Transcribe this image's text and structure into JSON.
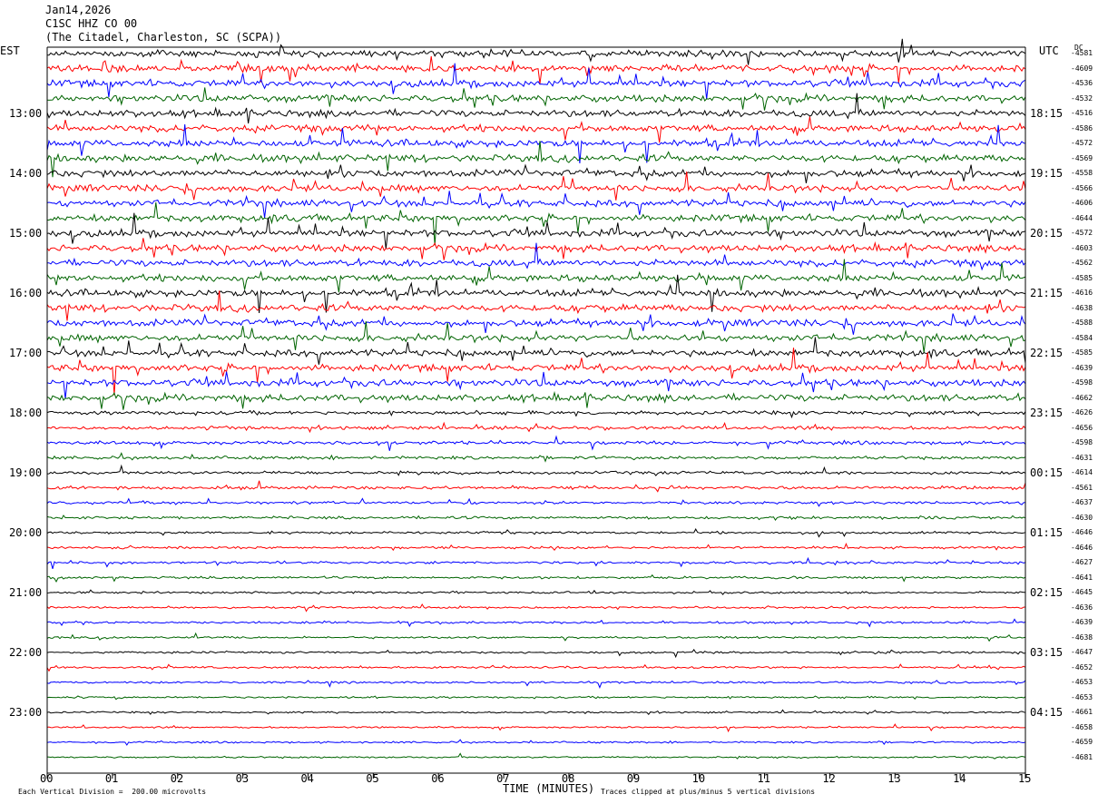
{
  "header": {
    "date": "Jan14,2026",
    "channel": "C1SC HHZ CO 00",
    "station": "(The Citadel, Charleston, SC (SCPA))"
  },
  "chart_data": {
    "type": "line",
    "title": "",
    "xlabel": "TIME (MINUTES)",
    "x_ticks": [
      "00",
      "01",
      "02",
      "03",
      "04",
      "05",
      "06",
      "07",
      "08",
      "09",
      "10",
      "11",
      "12",
      "13",
      "14",
      "15"
    ],
    "xlim": [
      0,
      15
    ],
    "left_axis_label": "EST",
    "right_axis_label": "UTC",
    "dc_label": "DC",
    "left_hour_labels": [
      "13:00",
      "14:00",
      "15:00",
      "16:00",
      "17:00",
      "18:00",
      "19:00",
      "20:00",
      "21:00",
      "22:00",
      "23:00"
    ],
    "right_hour_labels": [
      "18:15",
      "19:15",
      "20:15",
      "21:15",
      "22:15",
      "23:15",
      "00:15",
      "01:15",
      "02:15",
      "03:15",
      "04:15"
    ],
    "trace_colors": [
      "#000000",
      "#ff0000",
      "#0000ff",
      "#006400"
    ],
    "trace_offsets": [
      "-4581",
      "-4609",
      "-4536",
      "-4532",
      "-4516",
      "-4586",
      "-4572",
      "-4569",
      "-4558",
      "-4566",
      "-4606",
      "-4644",
      "-4572",
      "-4603",
      "-4562",
      "-4585",
      "-4616",
      "-4638",
      "-4588",
      "-4584",
      "-4585",
      "-4639",
      "-4598",
      "-4662",
      "-4626",
      "-4656",
      "-4598",
      "-4631",
      "-4614",
      "-4561",
      "-4637",
      "-4630",
      "-4646",
      "-4646",
      "-4627",
      "-4641",
      "-4645",
      "-4636",
      "-4639",
      "-4638",
      "-4647",
      "-4652",
      "-4653",
      "-4653",
      "-4661",
      "-4658",
      "-4659",
      "-4681"
    ],
    "trace_amplitude": [
      1.0,
      1.0,
      1.0,
      1.0,
      1.0,
      1.0,
      1.0,
      1.0,
      1.0,
      1.0,
      1.0,
      1.0,
      1.0,
      1.0,
      1.0,
      1.0,
      1.0,
      1.0,
      1.0,
      1.0,
      1.0,
      1.0,
      1.0,
      1.0,
      0.55,
      0.5,
      0.5,
      0.45,
      0.45,
      0.45,
      0.4,
      0.4,
      0.35,
      0.35,
      0.35,
      0.35,
      0.3,
      0.3,
      0.3,
      0.3,
      0.3,
      0.3,
      0.28,
      0.28,
      0.25,
      0.25,
      0.25,
      0.25
    ],
    "footer_left": "Each Vertical Division =  200.00 microvolts",
    "footer_right": "Traces clipped at plus/minus 5 vertical divisions"
  }
}
